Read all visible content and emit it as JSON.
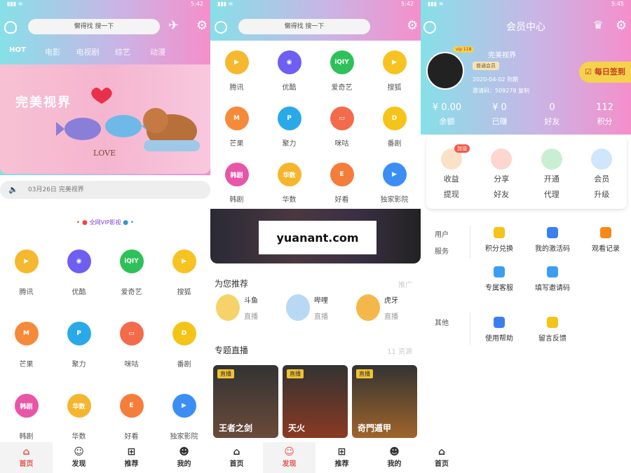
{
  "status": {
    "time1": "5:42",
    "time2": "5:42",
    "time3": "5:45"
  },
  "home": {
    "search_placeholder": "懒得找 搜一下",
    "tabs": [
      "HOT",
      "电影",
      "电视剧",
      "综艺",
      "动漫"
    ],
    "banner_title": "完美视界",
    "banner_love": "LOVE",
    "notice": "03月26日 完美视界",
    "vip_line": "全网VIP影视",
    "apps": [
      {
        "label": "腾讯",
        "color": "#f5b82e",
        "glyph": "▶"
      },
      {
        "label": "优酷",
        "color": "#6e5ef2",
        "glyph": "◉"
      },
      {
        "label": "爱奇艺",
        "color": "#2ec15a",
        "glyph": "iQIY"
      },
      {
        "label": "搜狐",
        "color": "#f7c322",
        "glyph": "▶"
      },
      {
        "label": "芒果",
        "color": "#f58a3a",
        "glyph": "M"
      },
      {
        "label": "聚力",
        "color": "#2aa9e8",
        "glyph": "P"
      },
      {
        "label": "咪咕",
        "color": "#f36b4a",
        "glyph": "▭"
      },
      {
        "label": "番剧",
        "color": "#f5c419",
        "glyph": "D"
      },
      {
        "label": "韩剧",
        "color": "#e856a8",
        "glyph": "韩剧"
      },
      {
        "label": "华数",
        "color": "#f5b62e",
        "glyph": "华数"
      },
      {
        "label": "好看",
        "color": "#f57d3a",
        "glyph": "E"
      },
      {
        "label": "独家影院",
        "color": "#3b8ff3",
        "glyph": "▶"
      }
    ]
  },
  "discover": {
    "search_placeholder": "懒得找 搜一下",
    "watermark": "yuanant.com",
    "rec_title": "为您推荐",
    "rec_more": "推广",
    "live": [
      {
        "name": "斗鱼",
        "sub": "直播",
        "color": "#f6d36a"
      },
      {
        "name": "哔哩",
        "sub": "直播",
        "color": "#b8d8f5"
      },
      {
        "name": "虎牙",
        "sub": "直播",
        "color": "#f4b84a"
      }
    ],
    "topic_title": "专题直播",
    "topic_more": "11 资源",
    "posters": [
      {
        "tag": "直播",
        "title": "王者之剑",
        "color": "#6a4a3a"
      },
      {
        "tag": "直播",
        "title": "天火",
        "color": "#8a3a22"
      },
      {
        "tag": "直播",
        "title": "奇門遁甲",
        "color": "#a0642a"
      }
    ]
  },
  "member": {
    "title": "会员中心",
    "user_badge": "vip 118",
    "user_name": "完美视界",
    "level": "普通会员",
    "expire": "2020-04-02 到期",
    "invite": "邀请码：509278 复制",
    "checkin": "每日签到",
    "stats": [
      {
        "value": "¥ 0.00",
        "label": "余额"
      },
      {
        "value": "¥ 0",
        "label": "已赚"
      },
      {
        "value": "0",
        "label": "好友"
      },
      {
        "value": "112",
        "label": "积分"
      }
    ],
    "actions": [
      {
        "line1": "收益",
        "line2": "提现",
        "color": "#fbe1c8",
        "badge": "加油"
      },
      {
        "line1": "分享",
        "line2": "好友",
        "color": "#fcd6cf"
      },
      {
        "line1": "开通",
        "line2": "代理",
        "color": "#c9efd2"
      },
      {
        "line1": "会员",
        "line2": "升级",
        "color": "#cfe6fb"
      }
    ],
    "svc_user_label": "用户\n服务",
    "svc_user_l1": "用户",
    "svc_user_l2": "服务",
    "svc_other": "其他",
    "services": [
      "积分兑换",
      "我的激活码",
      "观看记录",
      "专属客服",
      "填写邀请码"
    ],
    "others": [
      "使用帮助",
      "留言反馈"
    ]
  },
  "nav": {
    "home": "首页",
    "discover": "发现",
    "recommend": "推荐",
    "mine": "我的"
  }
}
